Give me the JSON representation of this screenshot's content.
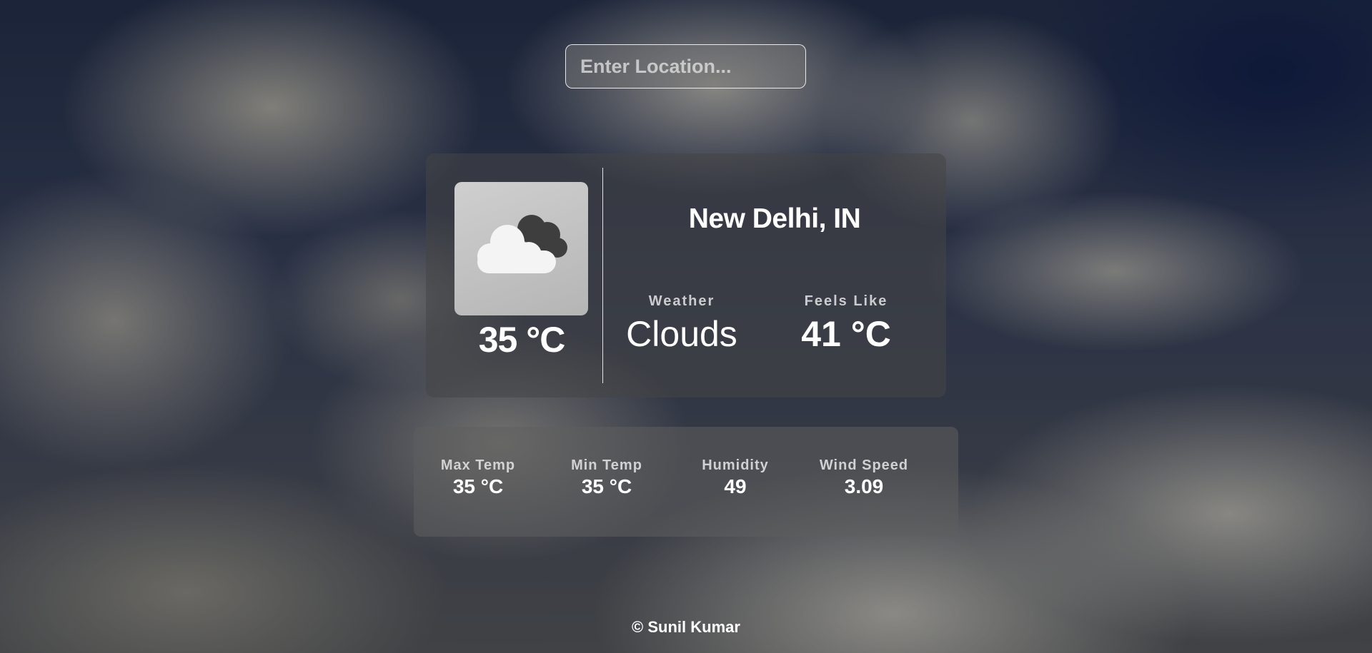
{
  "search": {
    "placeholder": "Enter Location..."
  },
  "current": {
    "icon": "cloud-icon",
    "temperature": "35 °C",
    "city": "New Delhi, IN",
    "weather_label": "Weather",
    "weather_value": "Clouds",
    "feels_like_label": "Feels Like",
    "feels_like_value": "41 °C"
  },
  "details": [
    {
      "label": "Max Temp",
      "value": "35 °C"
    },
    {
      "label": "Min Temp",
      "value": "35 °C"
    },
    {
      "label": "Humidity",
      "value": "49"
    },
    {
      "label": "Wind Speed",
      "value": "3.09"
    }
  ],
  "footer": {
    "text": "© Sunil Kumar"
  },
  "colors": {
    "text": "#ffffff",
    "card": "#464646",
    "icon_cloud_front": "#f4f4f4",
    "icon_cloud_back": "#3e3e3e"
  }
}
